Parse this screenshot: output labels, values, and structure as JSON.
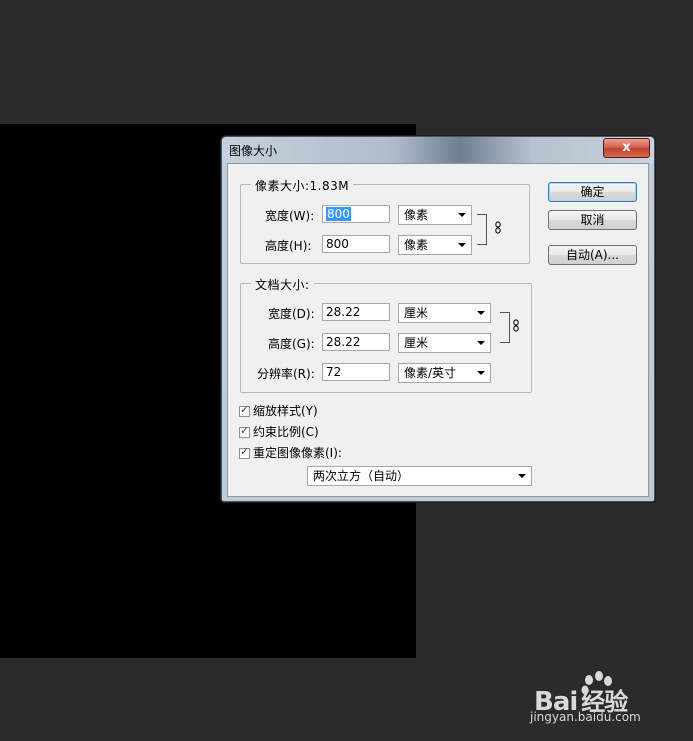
{
  "dialog": {
    "title": "图像大小",
    "close_label": "x",
    "pixel_dimensions": {
      "legend": "像素大小:1.83M",
      "width_label": "宽度(W):",
      "width_value": "800",
      "width_unit": "像素",
      "height_label": "高度(H):",
      "height_value": "800",
      "height_unit": "像素"
    },
    "document_size": {
      "legend": "文档大小:",
      "width_label": "宽度(D):",
      "width_value": "28.22",
      "width_unit": "厘米",
      "height_label": "高度(G):",
      "height_value": "28.22",
      "height_unit": "厘米",
      "resolution_label": "分辨率(R):",
      "resolution_value": "72",
      "resolution_unit": "像素/英寸"
    },
    "buttons": {
      "ok": "确定",
      "cancel": "取消",
      "auto": "自动(A)..."
    },
    "options": {
      "scale_styles": "缩放样式(Y)",
      "constrain_proportions": "约束比例(C)",
      "resample": "重定图像像素(I):",
      "resample_method": "两次立方（自动）"
    }
  },
  "watermark": {
    "logo_text": "Bai",
    "logo_suffix": "经验",
    "url": "jingyan.baidu.com"
  },
  "colors": {
    "workspace": "#2b2b2b",
    "canvas": "#000000",
    "selection": "#3399ff"
  }
}
